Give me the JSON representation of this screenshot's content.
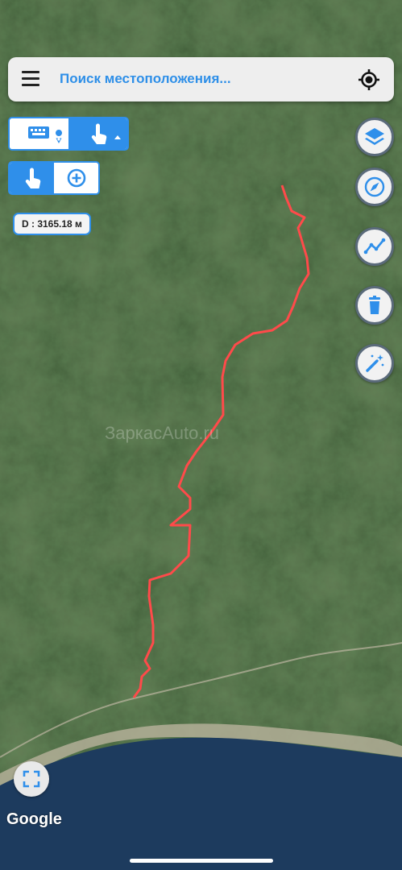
{
  "search": {
    "placeholder": "Поиск местоположения..."
  },
  "measurement": {
    "distance_label": "D : 3165.18 м"
  },
  "map": {
    "provider_logo": "Google",
    "route_color": "#ff4a4a",
    "land_color": "#3d5a36",
    "sea_color": "#1d3b5e"
  },
  "controls": {
    "input_mode": {
      "left_icon": "keyboard-icon",
      "right_icon": "hand-pointer-icon",
      "active": "right"
    },
    "tool_mode": {
      "left_icon": "hand-pointer-icon",
      "right_icon": "plus-circle-icon",
      "active": "left"
    },
    "side_buttons": [
      "layers-icon",
      "compass-icon",
      "route-chart-icon",
      "trash-icon",
      "magic-wand-icon"
    ],
    "fullscreen_icon": "fullscreen-icon",
    "accent": "#2f8fea"
  }
}
